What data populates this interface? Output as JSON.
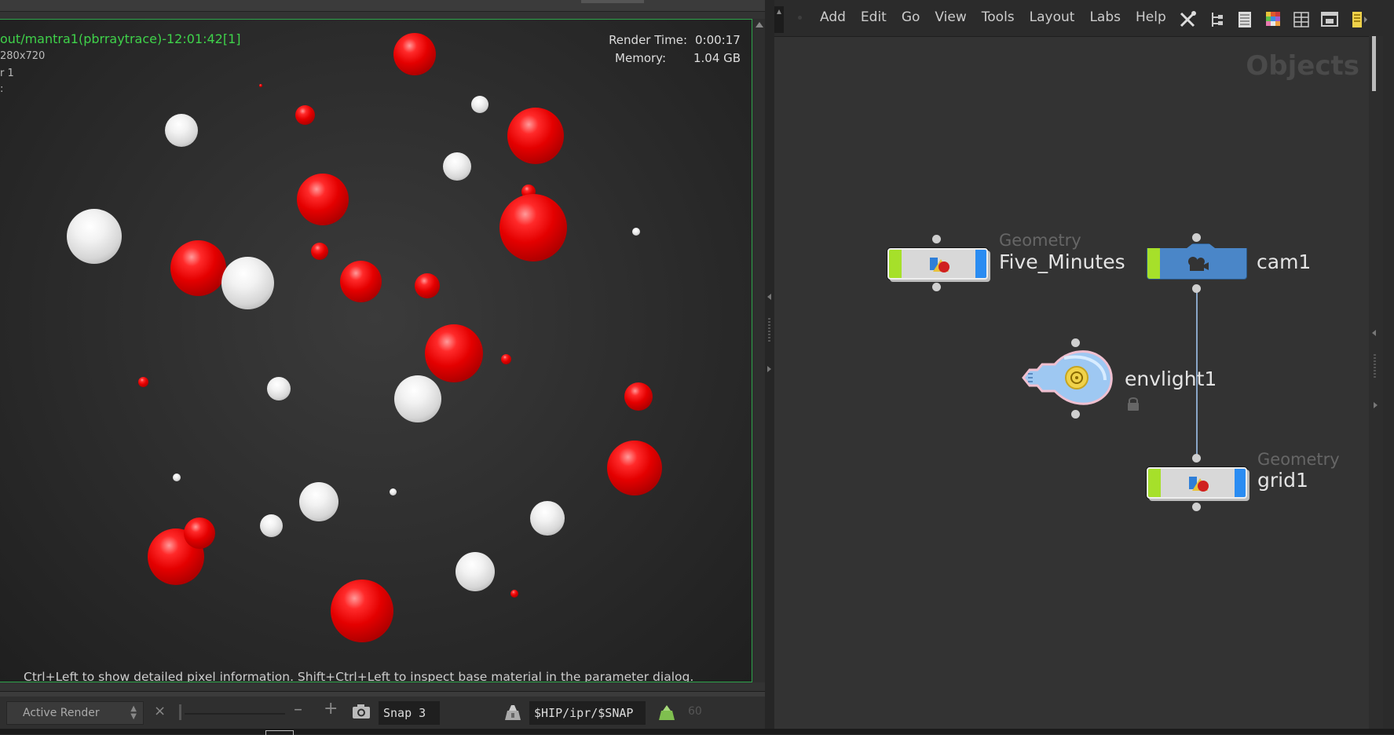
{
  "render_view": {
    "title": "out/mantra1(pbrraytrace)-12:01:42[1]",
    "resolution": "280x720",
    "info_line_1": "r 1",
    "info_line_2": ":",
    "render_time_label": "Render Time:",
    "render_time_value": "0:00:17",
    "memory_label": "Memory:",
    "memory_value": "1.04 GB",
    "hint": "Ctrl+Left to show detailed pixel information. Shift+Ctrl+Left to inspect base material in the parameter dialog.",
    "toolbar": {
      "render_mode": "Active Render",
      "close_glyph": "×",
      "zoom_minus": "–",
      "zoom_plus": "+",
      "snap_value": "Snap 3",
      "path_value": "$HIP/ipr/$SNAP",
      "frame_value": "60"
    }
  },
  "network_editor": {
    "menu": [
      "Add",
      "Edit",
      "Go",
      "View",
      "Tools",
      "Layout",
      "Labs",
      "Help"
    ],
    "tool_icons": [
      "wrench-icon",
      "tree-icon",
      "list-icon",
      "color-grid-icon",
      "tiles-icon",
      "window-icon",
      "note-icon"
    ],
    "context": "Objects",
    "nodes": {
      "five_minutes": {
        "type": "Geometry",
        "name": "Five_Minutes"
      },
      "cam1": {
        "name": "cam1"
      },
      "envlight1": {
        "name": "envlight1"
      },
      "grid1": {
        "type": "Geometry",
        "name": "grid1"
      }
    }
  },
  "colors": {
    "accent_green": "#3fd24a",
    "sphere_red": "#e40000",
    "node_green_flag": "#a6e02a",
    "node_blue_flag": "#2a8cf2",
    "camera_blue": "#4a86c8"
  }
}
